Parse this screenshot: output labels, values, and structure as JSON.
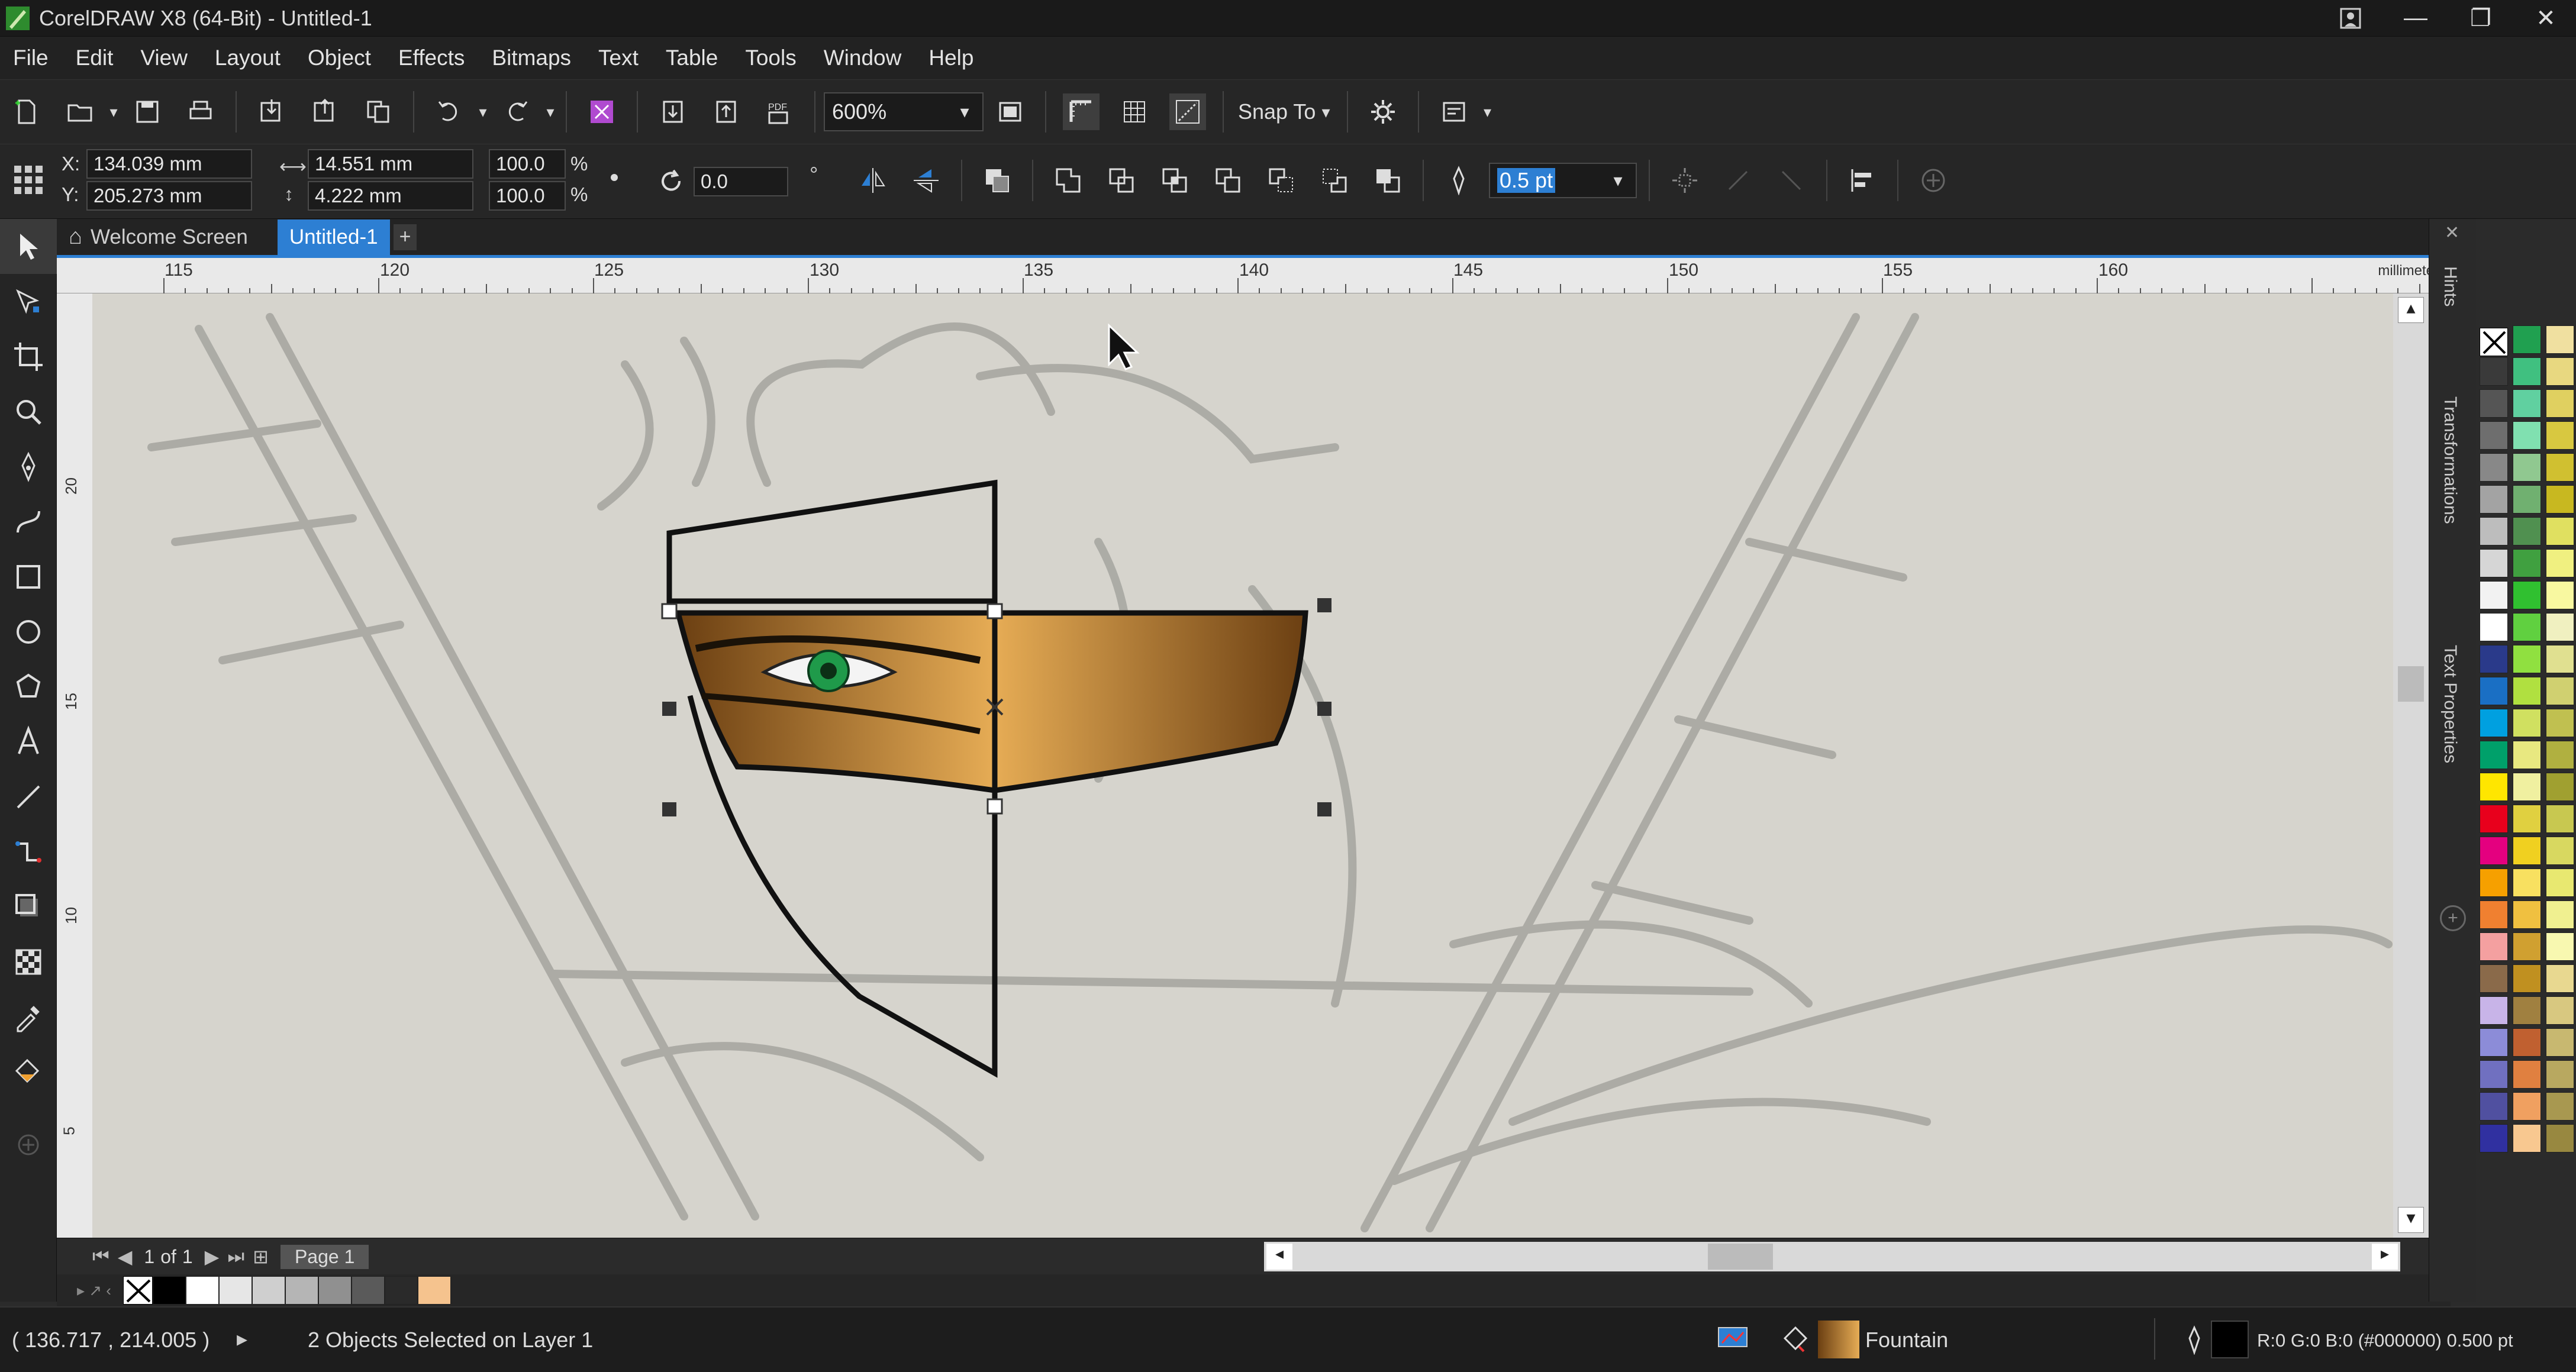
{
  "window": {
    "title": "CorelDRAW X8 (64-Bit) - Untitled-1"
  },
  "menu": [
    "File",
    "Edit",
    "View",
    "Layout",
    "Object",
    "Effects",
    "Bitmaps",
    "Text",
    "Table",
    "Tools",
    "Window",
    "Help"
  ],
  "toolbar": {
    "zoom_value": "600%",
    "snap_label": "Snap To"
  },
  "properties": {
    "x_label": "X:",
    "x_value": "134.039 mm",
    "y_label": "Y:",
    "y_value": "205.273 mm",
    "width_value": "14.551 mm",
    "height_value": "4.222 mm",
    "scale_x": "100.0",
    "scale_y": "100.0",
    "percent": "%",
    "rotation": "0.0",
    "outline_width": "0.5 pt"
  },
  "tabs": {
    "welcome": "Welcome Screen",
    "document": "Untitled-1"
  },
  "ruler": {
    "labels": [
      "115",
      "120",
      "125",
      "130",
      "135",
      "140",
      "145",
      "150",
      "155",
      "160"
    ],
    "units": "millimeters",
    "vlabels": [
      "20",
      "15",
      "10",
      "5"
    ]
  },
  "dockers": {
    "hints": "Hints",
    "transformations": "Transformations",
    "text_properties": "Text Properties"
  },
  "page_nav": {
    "current": "1",
    "of": "of",
    "total": "1",
    "page_tab": "Page 1"
  },
  "status": {
    "coords": "( 136.717 , 214.005 )",
    "selection": "2 Objects Selected on Layer 1",
    "fill_label": "Fountain",
    "outline_info": "R:0 G:0 B:0 (#000000) 0.500 pt"
  },
  "colors": {
    "accent": "#2d7fd3",
    "mask_dark": "#6b3f12",
    "mask_light": "#e6ac55",
    "eye_iris": "#1f9a4a",
    "canvas_bg": "#d6d4cd"
  },
  "palette": {
    "col1": [
      "#1a1a1a",
      "#3a3a3a",
      "#555555",
      "#6e6e6e",
      "#888888",
      "#a3a3a3",
      "#bdbdbd",
      "#d6d6d6",
      "#f2f2f2",
      "#ffffff",
      "#2a3a8a",
      "#1a6fc4",
      "#00a0e0",
      "#00a06a",
      "#ffe600",
      "#e8001c",
      "#e4007f",
      "#f6a000",
      "#f08030",
      "#f4a0a0",
      "#8a6a4a",
      "#c8b4e8",
      "#8c8cd8",
      "#7070c0",
      "#5050a0",
      "#3030a0"
    ],
    "col2": [
      "#20a050",
      "#40c080",
      "#60d0a0",
      "#80e0b0",
      "#90c890",
      "#70b070",
      "#509050",
      "#40a040",
      "#30c030",
      "#60d040",
      "#90e040",
      "#b0e040",
      "#d0e060",
      "#e8e880",
      "#f0f0a0",
      "#e0d040",
      "#f0d020",
      "#f8e060",
      "#f0c040",
      "#d0a030",
      "#c09020",
      "#a08040",
      "#c06030",
      "#e08040",
      "#f0a060",
      "#f8c890"
    ],
    "col3": [
      "#f0e0a0",
      "#e8d880",
      "#e0d060",
      "#d8c840",
      "#d0c030",
      "#c8b820",
      "#e0e060",
      "#f0f080",
      "#f8f8a0",
      "#f0f0c0",
      "#e0e090",
      "#d0d070",
      "#c0c050",
      "#b0b040",
      "#a0a030",
      "#c8c850",
      "#d8d860",
      "#e8e870",
      "#f0f090",
      "#f8f8b0",
      "#e8d890",
      "#d8c880",
      "#c8b870",
      "#b8a860",
      "#a89850",
      "#988840"
    ]
  }
}
